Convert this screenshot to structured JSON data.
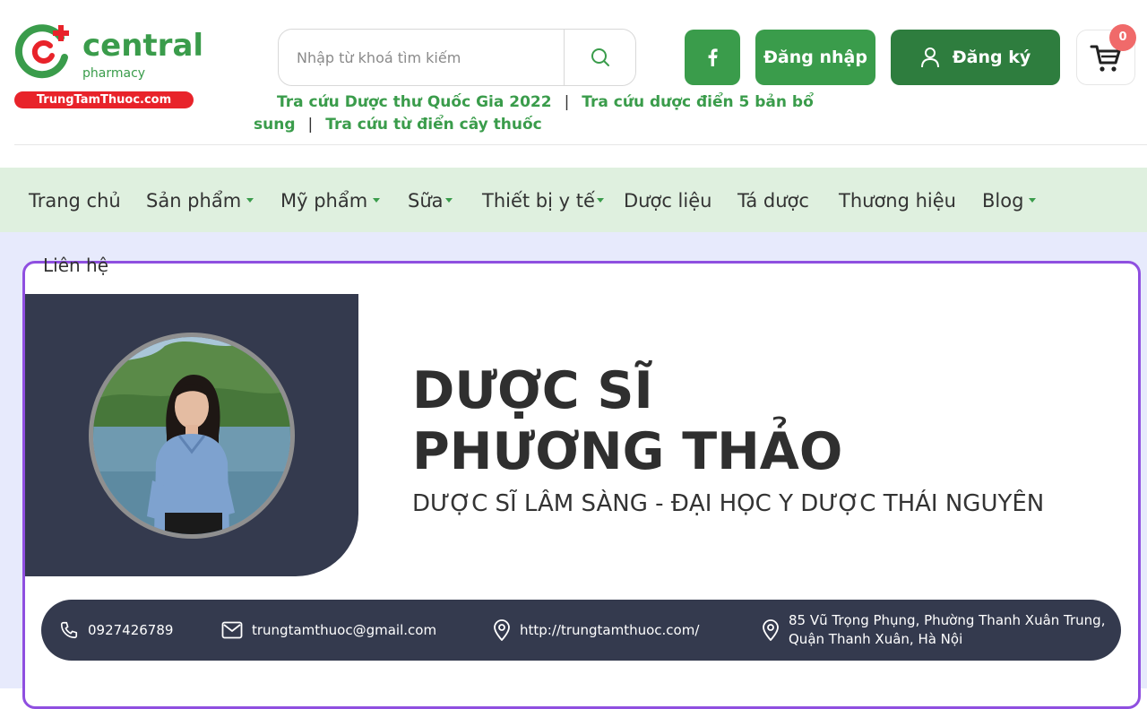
{
  "logo": {
    "brand": "central",
    "subtitle": "pharmacy",
    "pill": "TrungTamThuoc.com"
  },
  "search": {
    "placeholder": "Nhập từ khoá tìm kiếm"
  },
  "quicklinks": {
    "link1": "Tra cứu Dược thư Quốc Gia 2022",
    "link2": "Tra cứu dược điển 5 bản bổ sung",
    "link3": "Tra cứu từ điển cây thuốc",
    "separator": "|"
  },
  "header_buttons": {
    "login": "Đăng nhập",
    "register": "Đăng ký",
    "cart_count": "0"
  },
  "nav": {
    "items": [
      {
        "label": "Trang chủ"
      },
      {
        "label": "Sản phẩm"
      },
      {
        "label": "Mỹ phẩm"
      },
      {
        "label": "Sữa"
      },
      {
        "label": "Thiết bị y tế"
      },
      {
        "label": "Dược liệu"
      },
      {
        "label": "Tá dược"
      },
      {
        "label": "Thương hiệu"
      },
      {
        "label": "Blog"
      }
    ],
    "overflow_item": "Liên hệ"
  },
  "profile": {
    "name_line1": "DƯỢC SĨ",
    "name_line2": "PHƯƠNG THẢO",
    "subtitle": "DƯỢC SĨ LÂM SÀNG - ĐẠI HỌC Y DƯỢC THÁI NGUYÊN"
  },
  "contact": {
    "phone": "0927426789",
    "email": "trungtamthuoc@gmail.com",
    "website": "http://trungtamthuoc.com/",
    "address_line1": "85 Vũ Trọng Phụng, Phường Thanh Xuân Trung,",
    "address_line2": "Quận Thanh Xuân, Hà Nội"
  },
  "colors": {
    "brand_green": "#3a9c4b",
    "dark_green": "#2e7d3e",
    "nav_bg": "#dff0df",
    "page_bg": "#e7eafc",
    "card_border": "#8f4fe0",
    "panel_dark": "#343a4e",
    "logo_red": "#e8232a"
  }
}
